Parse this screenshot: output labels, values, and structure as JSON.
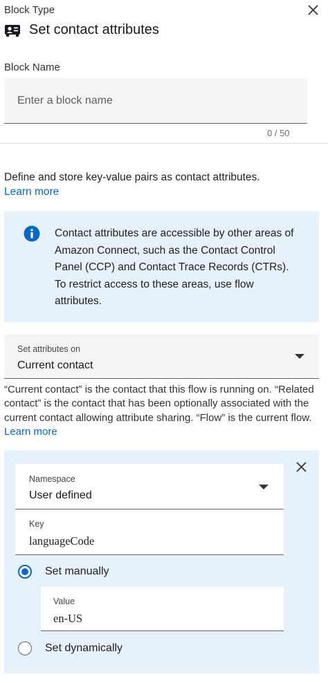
{
  "header": {
    "block_type_label": "Block Type",
    "title": "Set contact attributes",
    "title_icon": "contact-attributes-icon",
    "close_icon": "close-icon"
  },
  "block_name": {
    "label": "Block Name",
    "value": "",
    "placeholder": "Enter a block name",
    "counter": "0 / 50"
  },
  "description": {
    "text": "Define and store key-value pairs as contact attributes.",
    "learn_more": "Learn more"
  },
  "info": {
    "icon": "info-icon",
    "text": "Contact attributes are accessible by other areas of Amazon Connect, such as the Contact Control Panel (CCP) and Contact Trace Records (CTRs). To restrict access to these areas, use flow attributes."
  },
  "set_attributes_on": {
    "label": "Set attributes on",
    "value": "Current contact",
    "help_text": "“Current contact” is the contact that this flow is running on. “Related contact” is the contact that has been optionally associated with the current contact allowing attribute sharing. “Flow” is the current flow.",
    "learn_more": "Learn more"
  },
  "attribute": {
    "namespace_label": "Namespace",
    "namespace_value": "User defined",
    "key_label": "Key",
    "key_value": "languageCode",
    "set_manually_label": "Set manually",
    "set_manually_checked": true,
    "value_label": "Value",
    "value_value": "en-US",
    "set_dynamically_label": "Set dynamically",
    "set_dynamically_checked": false,
    "remove_icon": "close-icon"
  },
  "colors": {
    "accent": "#0a67c2",
    "info_background": "#e6f1fb",
    "field_background": "#f5f5f5"
  }
}
